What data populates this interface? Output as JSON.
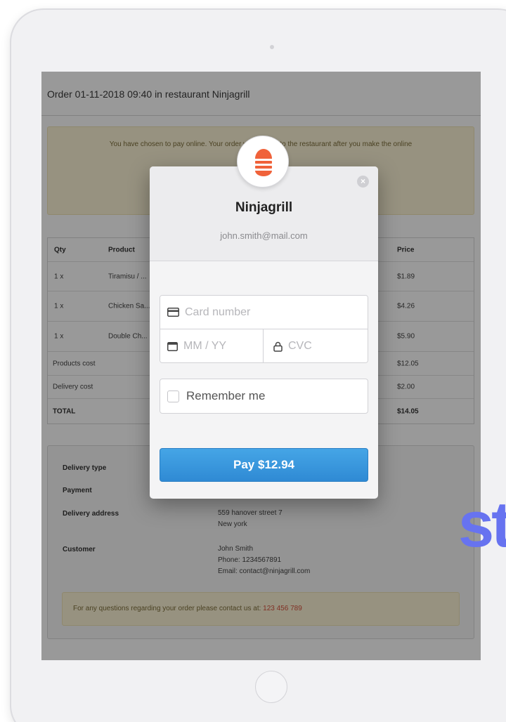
{
  "order": {
    "title": "Order 01-11-2018 09:40 in restaurant Ninjagrill",
    "notice": "You have chosen to pay online. Your order will be sent to the restaurant after you make the online",
    "table": {
      "headers": {
        "qty": "Qty",
        "product": "Product",
        "price": "Price"
      },
      "items": [
        {
          "qty": "1 x",
          "product": "Tiramisu / ...",
          "price": "$1.89"
        },
        {
          "qty": "1 x",
          "product": "Chicken Sa...",
          "price": "$4.26"
        },
        {
          "qty": "1 x",
          "product": "Double Ch...",
          "price": "$5.90"
        }
      ],
      "summary": [
        {
          "label": "Products cost",
          "value": "$12.05"
        },
        {
          "label": "Delivery cost",
          "value": "$2.00"
        },
        {
          "label": "TOTAL",
          "value": "$14.05"
        }
      ]
    },
    "details": {
      "delivery_type_label": "Delivery type",
      "payment_label": "Payment",
      "address_label": "Delivery address",
      "address_line1": "559 hanover street 7",
      "address_line2": "New york",
      "customer_label": "Customer",
      "customer_name": "John Smith",
      "customer_phone": "Phone: 1234567891",
      "customer_email": "Email: contact@ninjagrill.com"
    },
    "contact": {
      "text": "For any questions regarding your order please contact us at:",
      "phone": "123 456 789"
    }
  },
  "side_logo": "st",
  "modal": {
    "merchant_name": "Ninjagrill",
    "merchant_email": "john.smith@mail.com",
    "close_glyph": "×",
    "card_placeholder": "Card number",
    "expiry_placeholder": "MM / YY",
    "cvc_placeholder": "CVC",
    "remember_label": "Remember me",
    "pay_label": "Pay $12.94"
  },
  "colors": {
    "brand_orange": "#f0623a",
    "pay_blue": "#3896dc",
    "side_logo": "#6773f0"
  }
}
